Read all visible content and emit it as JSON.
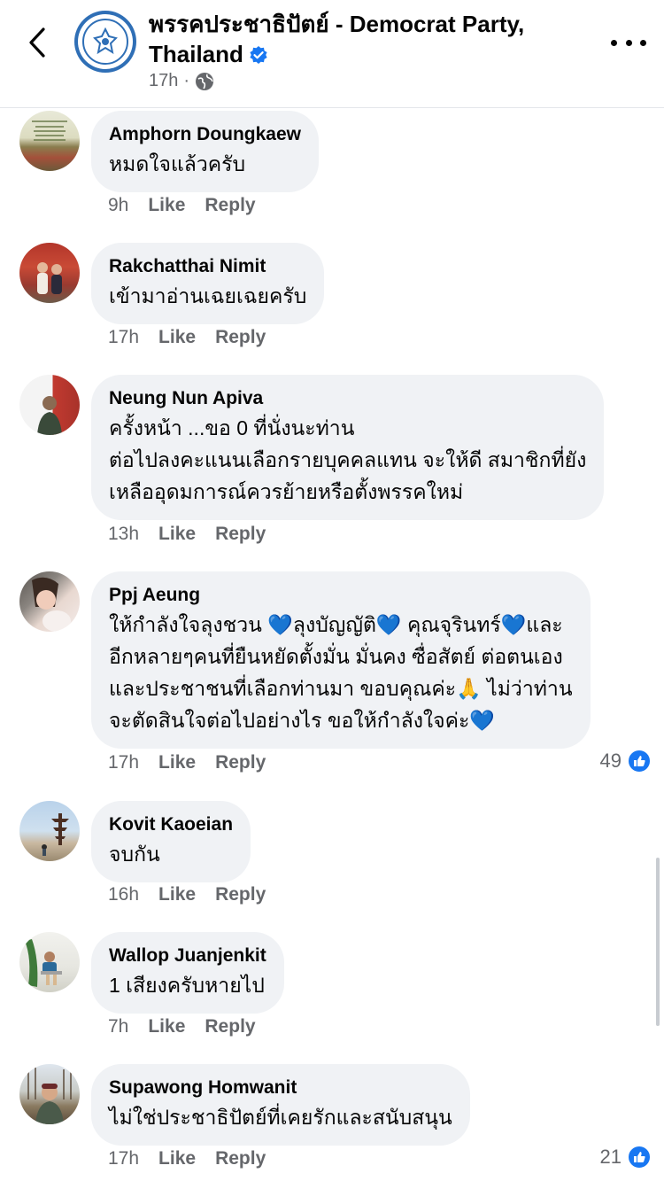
{
  "header": {
    "title": "พรรคประชาธิปัตย์ - Democrat Party, Thailand",
    "time": "17h",
    "separator": "·"
  },
  "actions": {
    "like": "Like",
    "reply": "Reply"
  },
  "comments": [
    {
      "name": "Amphorn Doungkaew",
      "lines": [
        "หมดใจแล้วครับ"
      ],
      "time": "9h"
    },
    {
      "name": "Rakchatthai Nimit",
      "lines": [
        "เข้ามาอ่านเฉยเฉยครับ"
      ],
      "time": "17h"
    },
    {
      "name": "Neung Nun Apiva",
      "lines": [
        "ครั้งหน้า ...ขอ 0 ที่นั่งนะท่าน",
        "ต่อไปลงคะแนนเลือกรายบุคคลแทน จะให้ดี สมาชิกที่ยัง",
        "เหลืออุดมการณ์ควรย้ายหรือตั้งพรรคใหม่"
      ],
      "time": "13h"
    },
    {
      "name": "Ppj Aeung",
      "lines": [
        "ให้กำลังใจลุงชวน 💙ลุงบัญญัติ💙 คุณจุรินทร์💙และ",
        "อีกหลายๆคนที่ยืนหยัดตั้งมั่น มั่นคง ซื่อสัตย์ ต่อตนเอง",
        "และประชาชนที่เลือกท่านมา  ขอบคุณค่ะ🙏  ไม่ว่าท่าน",
        "จะตัดสินใจต่อไปอย่างไร ขอให้กำลังใจค่ะ💙"
      ],
      "time": "17h",
      "reactions": "49"
    },
    {
      "name": "Kovit Kaoeian",
      "lines": [
        "จบกัน"
      ],
      "time": "16h"
    },
    {
      "name": "Wallop Juanjenkit",
      "lines": [
        "1 เสียงครับหายไป"
      ],
      "time": "7h"
    },
    {
      "name": "Supawong Homwanit",
      "lines": [
        "ไม่ใช่ประชาธิปัตย์ที่เคยรักและสนับสนุน"
      ],
      "time": "17h",
      "reactions": "21"
    }
  ],
  "colors": {
    "accent": "#1877f2",
    "bubble": "#f0f2f5",
    "secondary_text": "#65676b"
  },
  "icons": {
    "back": "chevron-left-icon",
    "more": "more-horizontal-icon",
    "verified": "verified-badge-icon",
    "audience": "globe-icon",
    "reaction": "like-reaction-icon"
  }
}
